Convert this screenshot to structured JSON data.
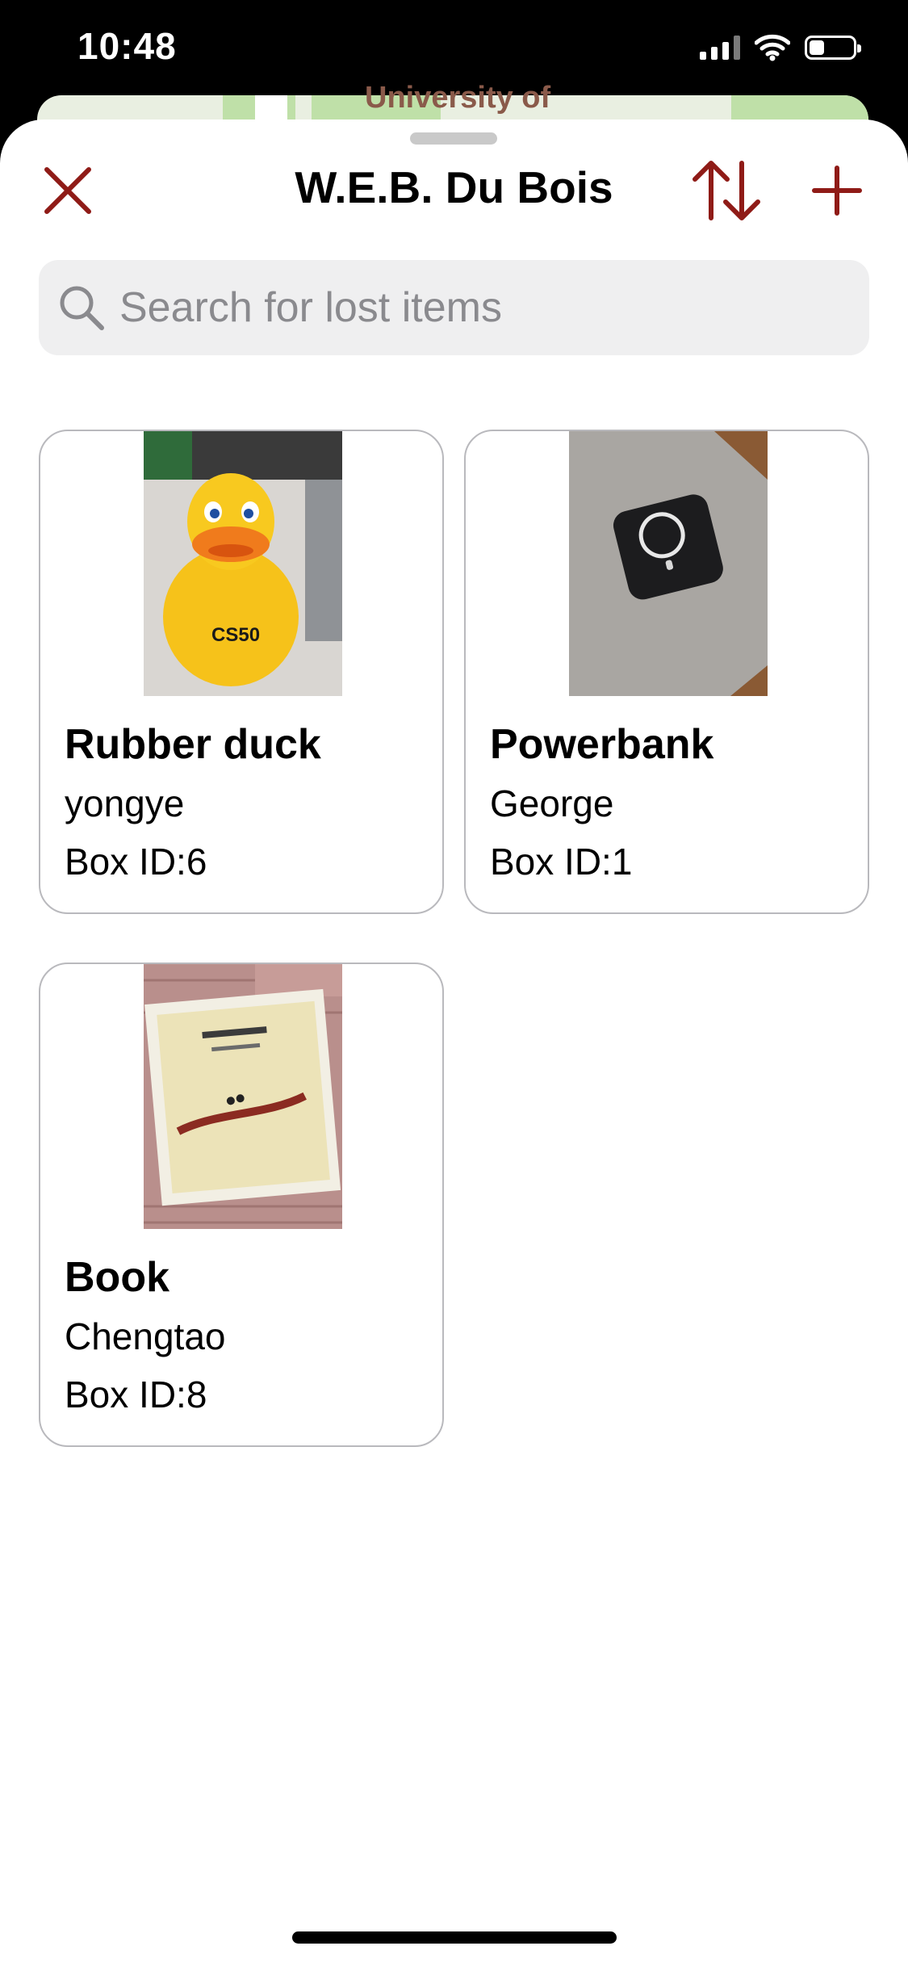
{
  "status_bar": {
    "time": "10:48",
    "signal_bars": 4,
    "signal_strength": 3,
    "battery_level": 0.35
  },
  "map": {
    "label": "University of"
  },
  "header": {
    "title": "W.E.B. Du Bois",
    "close_icon": "close-icon",
    "sort_icon": "sort-arrows-icon",
    "add_icon": "plus-icon"
  },
  "search": {
    "placeholder": "Search for lost items",
    "value": "",
    "icon": "search-icon"
  },
  "items": [
    {
      "title": "Rubber duck",
      "owner": "yongye",
      "box": "Box ID:6",
      "photo": "rubber-duck-photo"
    },
    {
      "title": "Powerbank",
      "owner": "George",
      "box": "Box ID:1",
      "photo": "powerbank-photo"
    },
    {
      "title": "Book",
      "owner": "Chengtao",
      "box": "Box ID:8",
      "photo": "book-photo"
    }
  ],
  "colors": {
    "accent": "#8f1b17",
    "card_border": "#b9b9bd",
    "search_bg": "#efeff0",
    "placeholder": "#8a8a8e"
  }
}
